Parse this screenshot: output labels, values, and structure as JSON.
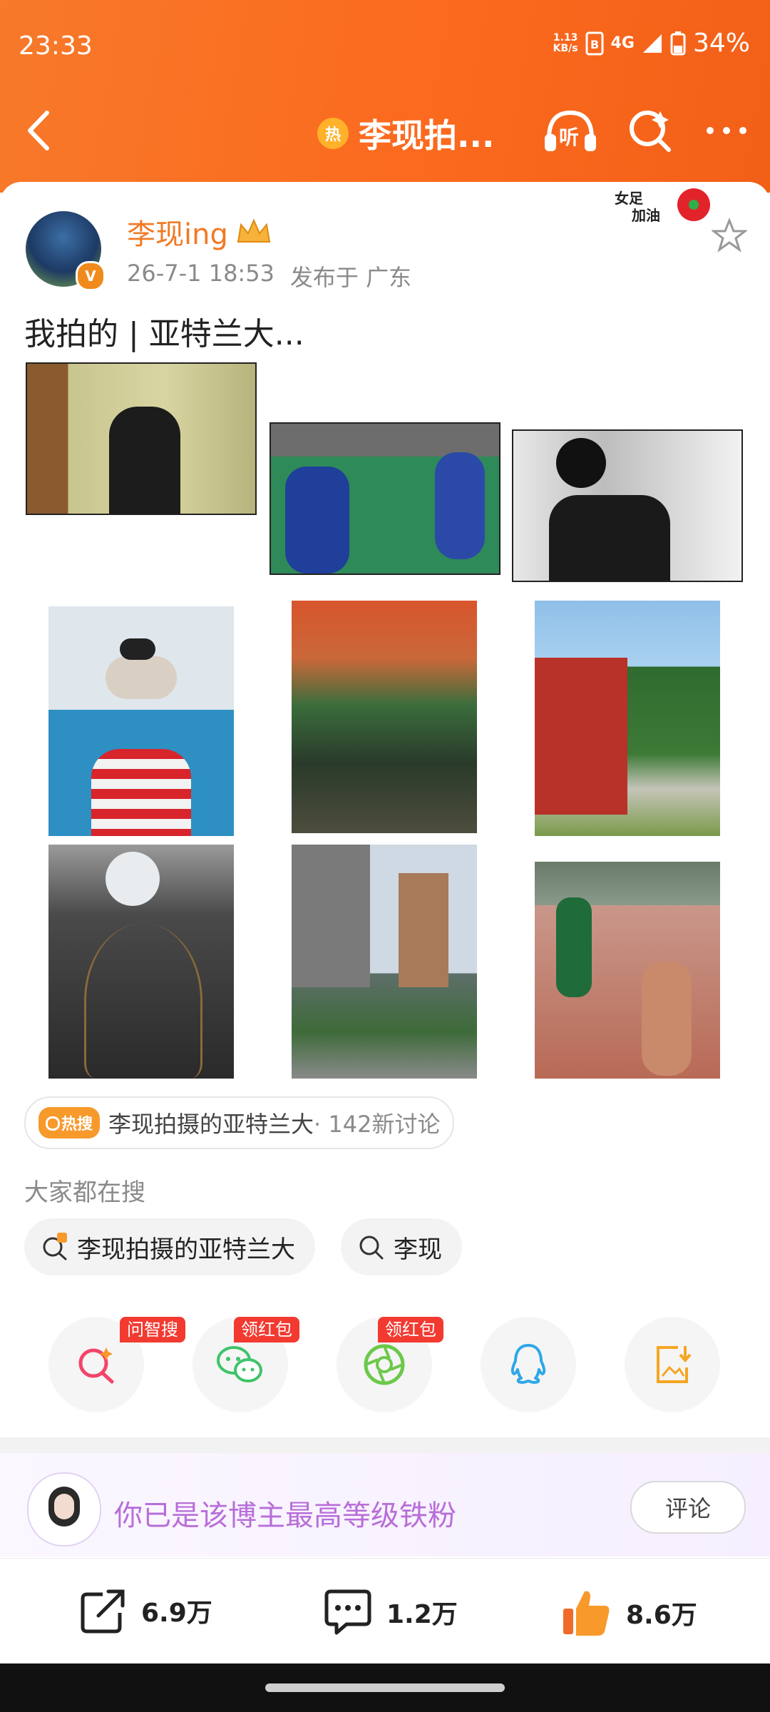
{
  "status_bar": {
    "time": "23:33",
    "net_speed_value": "1.13",
    "net_speed_unit": "KB/s",
    "network": "4G",
    "battery": "34%"
  },
  "nav": {
    "hot_icon": "热",
    "title": "李现拍..."
  },
  "post": {
    "username": "李现ing",
    "verified_badge": "V",
    "date": "26-7-1 18:53",
    "location": "发布于 广东",
    "sticker_line1": "女足",
    "sticker_line2": "加油",
    "text": "我拍的 | 亚特兰大..."
  },
  "hot_topic": {
    "tag": "热搜",
    "title": "李现拍摄的亚特兰大",
    "count": " · 142新讨论"
  },
  "search": {
    "label": "大家都在搜",
    "chips": [
      "李现拍摄的亚特兰大",
      "李现"
    ]
  },
  "share": {
    "badges": [
      "问智搜",
      "领红包",
      "领红包"
    ],
    "items": [
      "search-ai-icon",
      "wechat-icon",
      "moments-icon",
      "qq-icon",
      "save-image-icon"
    ]
  },
  "fan": {
    "text": "你已是该博主最高等级铁粉",
    "comment_button": "评论"
  },
  "actions": {
    "repost": "6.9万",
    "comment": "1.2万",
    "like": "8.6万"
  },
  "colors": {
    "header_orange": "#f8792a",
    "username_orange": "#f07a25",
    "fan_purple": "#b86ed8",
    "badge_red": "#f23a31"
  }
}
